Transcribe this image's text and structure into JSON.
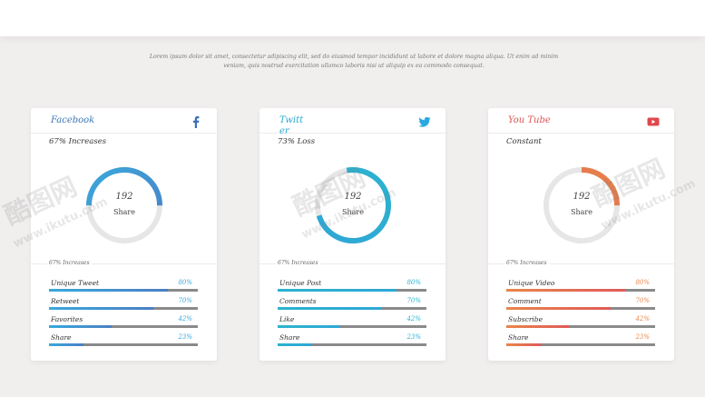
{
  "intro_text": "Lorem ipsum dolor sit amet, consectetur adipiscing elit, sed do eiusmod tempor incididunt ut labore et dolore magna aliqua. Ut enim ad minim veniam, quis nostrud exercitation ullamco laboris nisi ut aliquip ex ea commodo consequat.",
  "cards": [
    {
      "title": "Facebook",
      "icon": "facebook-icon",
      "accent": "#3aa8dc",
      "accent2": "#4b7fc4",
      "title_color": "#3b78b5",
      "status": "67% Increases",
      "donut_value": "192",
      "donut_label": "Share",
      "donut_fraction": 0.5,
      "divider_text": "67% Increases",
      "metrics": [
        {
          "label": "Unique Tweet",
          "value": "80%",
          "fraction": 0.8
        },
        {
          "label": "Retweet",
          "value": "70%",
          "fraction": 0.7
        },
        {
          "label": "Favorites",
          "value": "42%",
          "fraction": 0.42
        },
        {
          "label": "Share",
          "value": "23%",
          "fraction": 0.23
        }
      ]
    },
    {
      "title": "Twitter",
      "icon": "twitter-icon",
      "accent": "#2bb3cf",
      "accent2": "#2fa7d6",
      "title_color": "#2aa9d0",
      "status": "73% Loss",
      "donut_value": "192",
      "donut_label": "Share",
      "donut_fraction": 0.73,
      "divider_text": "67% Increases",
      "metrics": [
        {
          "label": "Unique Post",
          "value": "80%",
          "fraction": 0.8
        },
        {
          "label": "Comments",
          "value": "70%",
          "fraction": 0.7
        },
        {
          "label": "Like",
          "value": "42%",
          "fraction": 0.42
        },
        {
          "label": "Share",
          "value": "23%",
          "fraction": 0.23
        }
      ]
    },
    {
      "title": "You Tube",
      "icon": "youtube-icon",
      "accent": "#e8864a",
      "accent2": "#e05a5a",
      "title_color": "#d9534f",
      "status": "Constant",
      "donut_value": "192",
      "donut_label": "Share",
      "donut_fraction": 0.25,
      "divider_text": "67% Increases",
      "metrics": [
        {
          "label": "Unique Video",
          "value": "80%",
          "fraction": 0.8
        },
        {
          "label": "Comment",
          "value": "70%",
          "fraction": 0.7
        },
        {
          "label": "Subscribe",
          "value": "42%",
          "fraction": 0.42
        },
        {
          "label": "Share",
          "value": "23%",
          "fraction": 0.23
        }
      ]
    }
  ],
  "watermark": {
    "text_cn": "酷图网",
    "text_url": "www.ikutu.com"
  }
}
